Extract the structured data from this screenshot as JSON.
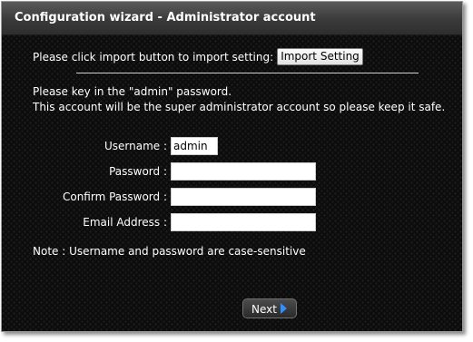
{
  "window": {
    "title": "Configuration wizard - Administrator account"
  },
  "import": {
    "prompt": "Please click import button to import setting:",
    "button_label": "Import Setting"
  },
  "instructions": {
    "line1": "Please key in the \"admin\" password.",
    "line2": "This account will be the super administrator account so please keep it safe."
  },
  "form": {
    "username_label": "Username :",
    "username_value": "admin",
    "password_label": "Password :",
    "password_value": "",
    "confirm_label": "Confirm Password :",
    "confirm_value": "",
    "email_label": "Email Address :",
    "email_value": ""
  },
  "note": "Note : Username and password are case-sensitive",
  "footer": {
    "next_label": "Next",
    "next_icon": "chevron-right-icon",
    "accent_color": "#2f8fff"
  }
}
